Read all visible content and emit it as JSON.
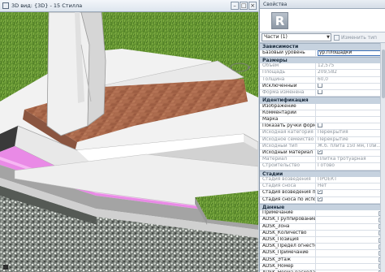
{
  "view_window": {
    "title": "3D вид: {3D} - 15 Стилла",
    "controls": [
      "–",
      "□",
      "×"
    ]
  },
  "properties": {
    "title": "Свойства",
    "type_thumbnail_letter": "R",
    "instance_selector": "Части (1)",
    "edit_type_label": "Изменить тип",
    "groups": [
      {
        "name": "Зависимости",
        "rows": [
          {
            "name": "Базовый уровень",
            "value": "ур.площадки",
            "kind": "edit"
          }
        ]
      },
      {
        "name": "Размеры",
        "rows": [
          {
            "name": "Объем",
            "value": "12,575",
            "kind": "dim"
          },
          {
            "name": "Площадь",
            "value": "209,582",
            "kind": "dim"
          },
          {
            "name": "Толщина",
            "value": "60,0",
            "kind": "dim"
          },
          {
            "name": "Исключенный",
            "value": "",
            "kind": "check",
            "checked": false
          },
          {
            "name": "Форма изменена",
            "value": "",
            "kind": "check-dim",
            "checked": false
          }
        ]
      },
      {
        "name": "Идентификация",
        "rows": [
          {
            "name": "Изображение",
            "value": "",
            "kind": "plain"
          },
          {
            "name": "Комментарии",
            "value": "",
            "kind": "plain"
          },
          {
            "name": "Марка",
            "value": "",
            "kind": "plain"
          },
          {
            "name": "Показать ручки формы",
            "value": "",
            "kind": "check",
            "checked": false
          },
          {
            "name": "Исходная категория",
            "value": "Перекрытия",
            "kind": "dim"
          },
          {
            "name": "Исходное семейство",
            "value": "Перекрытие",
            "kind": "dim"
          },
          {
            "name": "Исходный тип",
            "value": "Ж.б. плита 150 мм, Пли...",
            "kind": "dim"
          },
          {
            "name": "Исходный материал",
            "value": "",
            "kind": "check",
            "checked": true
          },
          {
            "name": "Материал",
            "value": "Плитка тротуарная",
            "kind": "dim"
          },
          {
            "name": "Строительство",
            "value": "Готово",
            "kind": "dim"
          }
        ]
      },
      {
        "name": "Стадии",
        "rows": [
          {
            "name": "Стадия возведения",
            "value": "ПРОЕКТ",
            "kind": "dim"
          },
          {
            "name": "Стадия сноса",
            "value": "Нет",
            "kind": "dim"
          },
          {
            "name": "Стадия возведения по ...",
            "value": "",
            "kind": "check",
            "checked": true
          },
          {
            "name": "Стадия сноса по испол...",
            "value": "",
            "kind": "check",
            "checked": true
          }
        ]
      },
      {
        "name": "Данные",
        "rows": [
          {
            "name": "Примечание",
            "value": "",
            "kind": "button"
          },
          {
            "name": "ADSK_Группирование",
            "value": "",
            "kind": "button"
          },
          {
            "name": "ADSK_Зона",
            "value": "",
            "kind": "button"
          },
          {
            "name": "ADSK_Количество",
            "value": "",
            "kind": "button"
          },
          {
            "name": "ADSK_Позиция",
            "value": "",
            "kind": "button"
          },
          {
            "name": "ADSK_Предел огнестой...",
            "value": "",
            "kind": "button"
          },
          {
            "name": "ADSK_Примечание",
            "value": "",
            "kind": "button"
          },
          {
            "name": "ADSK_Этаж",
            "value": "",
            "kind": "button"
          },
          {
            "name": "ADSK_Номер",
            "value": "",
            "kind": "button"
          },
          {
            "name": "ADSK_Норма расхода",
            "value": "",
            "kind": "button"
          }
        ]
      }
    ]
  }
}
